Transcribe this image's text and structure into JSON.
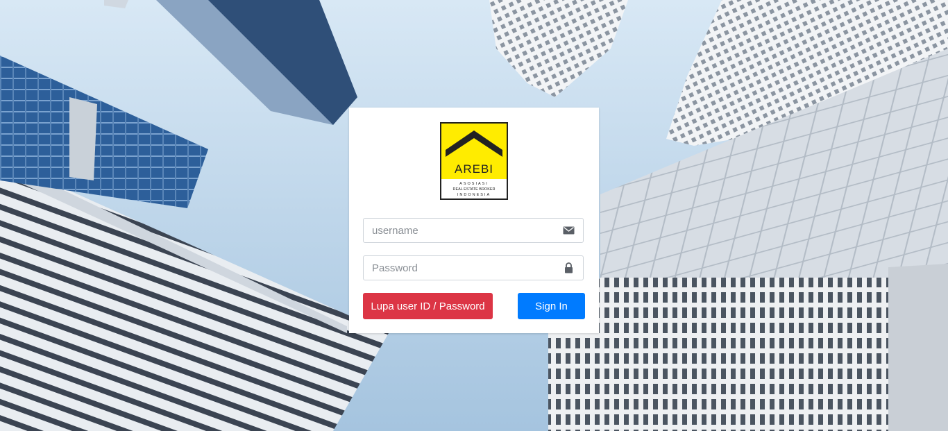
{
  "logo": {
    "brand": "AREBI",
    "line1": "ASOSIASI",
    "line2": "REAL ESTATE BROKER",
    "line3": "INDONESIA"
  },
  "login": {
    "username_placeholder": "username",
    "username_icon": "envelope-icon",
    "password_placeholder": "Password",
    "password_icon": "lock-icon",
    "forgot_label": "Lupa user ID / Password",
    "signin_label": "Sign In"
  },
  "colors": {
    "forgot_button": "#dc3545",
    "signin_button": "#007bff",
    "logo_yellow": "#ffec00"
  }
}
